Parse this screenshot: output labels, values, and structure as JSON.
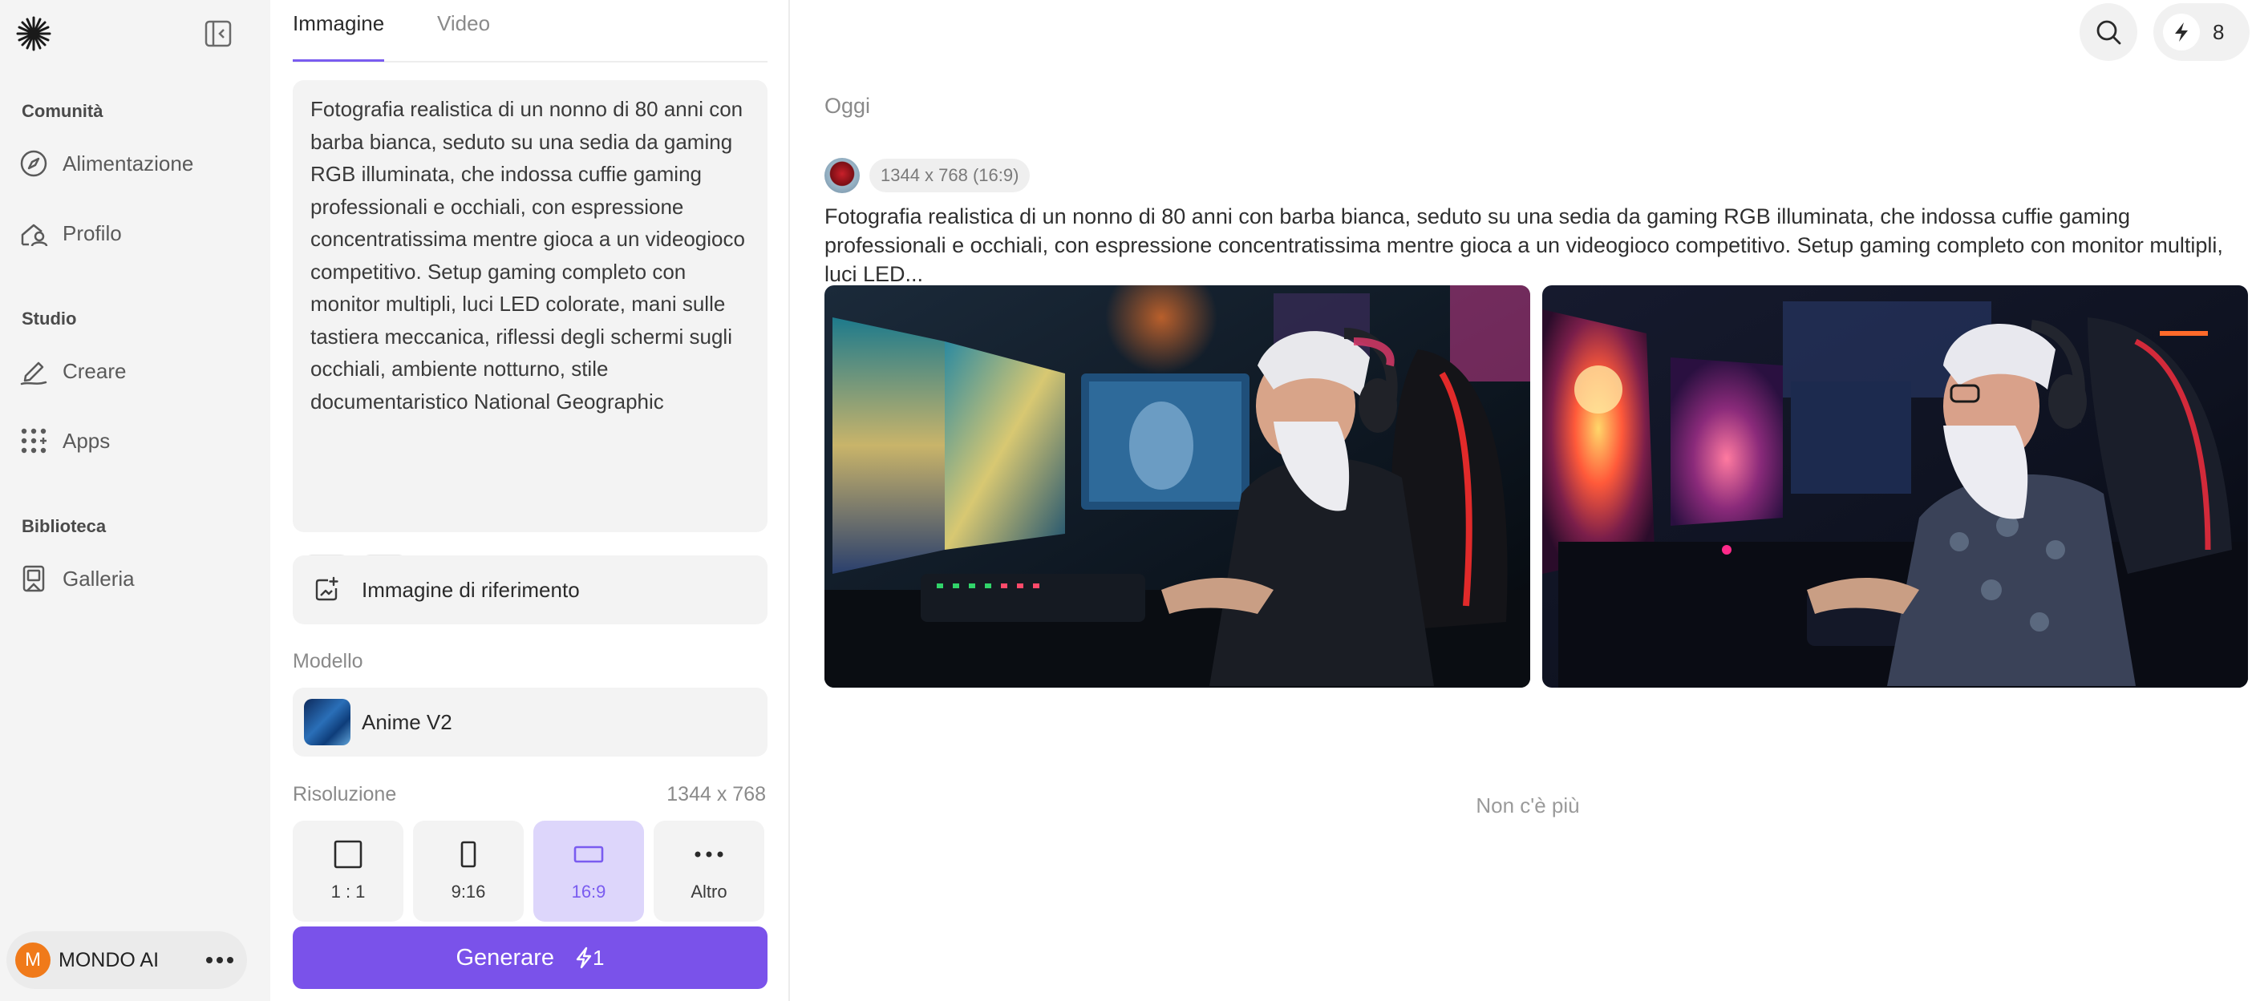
{
  "sidebar": {
    "sections": [
      {
        "title": "Comunità",
        "items": [
          {
            "label": "Alimentazione",
            "icon": "compass-icon"
          },
          {
            "label": "Profilo",
            "icon": "user-icon"
          }
        ]
      },
      {
        "title": "Studio",
        "items": [
          {
            "label": "Creare",
            "icon": "pen-icon"
          },
          {
            "label": "Apps",
            "icon": "apps-grid-icon"
          }
        ]
      },
      {
        "title": "Biblioteca",
        "items": [
          {
            "label": "Galleria",
            "icon": "gallery-icon"
          }
        ]
      }
    ],
    "user": {
      "initial": "M",
      "name": "MONDO AI"
    }
  },
  "panel": {
    "tabs": [
      {
        "label": "Immagine",
        "active": true
      },
      {
        "label": "Video",
        "active": false
      }
    ],
    "prompt": "Fotografia realistica di un nonno di 80 anni con barba bianca, seduto su una sedia da gaming RGB illuminata, che indossa cuffie gaming professionali e occhiali, con espressione concentratissima mentre gioca a un videogioco competitivo. Setup gaming completo con monitor multipli, luci LED colorate, mani sulle tastiera meccanica, riflessi degli schermi sugli occhiali, ambiente notturno, stile documentaristico National Geographic",
    "reference_image_label": "Immagine di riferimento",
    "model_label": "Modello",
    "model_name": "Anime V2",
    "resolution_label": "Risoluzione",
    "resolution_value": "1344 x 768",
    "ratios": [
      {
        "label": "1 : 1",
        "active": false
      },
      {
        "label": "9:16",
        "active": false
      },
      {
        "label": "16:9",
        "active": true
      },
      {
        "label": "Altro",
        "active": false
      }
    ],
    "generate_label": "Generare",
    "generate_cost": "1"
  },
  "header": {
    "credits": "8"
  },
  "feed": {
    "date_label": "Oggi",
    "size_badge": "1344 x 768 (16:9)",
    "caption": "Fotografia realistica di un nonno di 80 anni con barba bianca, seduto su una sedia da gaming RGB illuminata, che indossa cuffie gaming professionali e occhiali, con espressione concentratissima mentre gioca a un videogioco competitivo. Setup gaming completo con monitor multipli, luci LED...",
    "end_text": "Non c'è più"
  },
  "colors": {
    "accent": "#7a52ea",
    "accent_light": "#ddd6fb",
    "sidebar_bg": "#f4f4f4"
  }
}
